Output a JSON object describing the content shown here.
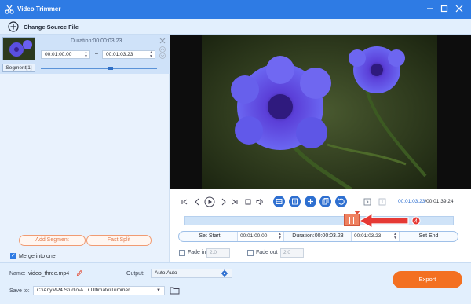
{
  "window": {
    "title": "Video Trimmer"
  },
  "toolbar": {
    "change_source_label": "Change Source File"
  },
  "segment": {
    "label": "Segment[1]",
    "duration": "Duration:00:00:03.23",
    "start_time": "00:01:00.00",
    "dash": "–",
    "end_time": "00:01:03.23"
  },
  "left_actions": {
    "add_segment": "Add Segment",
    "fast_split": "Fast Split",
    "merge_label": "Merge into one",
    "merge_checked": true
  },
  "player": {
    "current_time": "00:01:03.23",
    "total_time": "/00:01:39.24",
    "icons": [
      "skip-start-icon",
      "prev-frame-icon",
      "play-icon",
      "next-frame-icon",
      "skip-end-icon",
      "stop-icon",
      "volume-icon",
      "rotate-icon",
      "crop-icon",
      "add-icon",
      "copy-icon",
      "reset-icon",
      "mark-in-icon",
      "mark-out-icon"
    ]
  },
  "timeline": {
    "selection_marker": "4"
  },
  "trim": {
    "set_start": "Set Start",
    "start_value": "00:01:00.00",
    "duration": "Duration:00:00:03.23",
    "end_value": "00:01:03.23",
    "set_end": "Set End"
  },
  "fade": {
    "fade_in_label": "Fade in",
    "fade_in_value": "2.0",
    "fade_out_label": "Fade out",
    "fade_out_value": "2.0"
  },
  "footer": {
    "name_label": "Name:",
    "name_value": "video_three.mp4",
    "output_label": "Output:",
    "output_value": "Auto;Auto",
    "save_label": "Save to:",
    "save_value": "C:\\AnyMP4 Studio\\A...r Ultimate\\Trimmer",
    "export_label": "Export"
  },
  "colors": {
    "accent": "#2e7be4",
    "export": "#f37021",
    "annotation": "#e2503a"
  }
}
